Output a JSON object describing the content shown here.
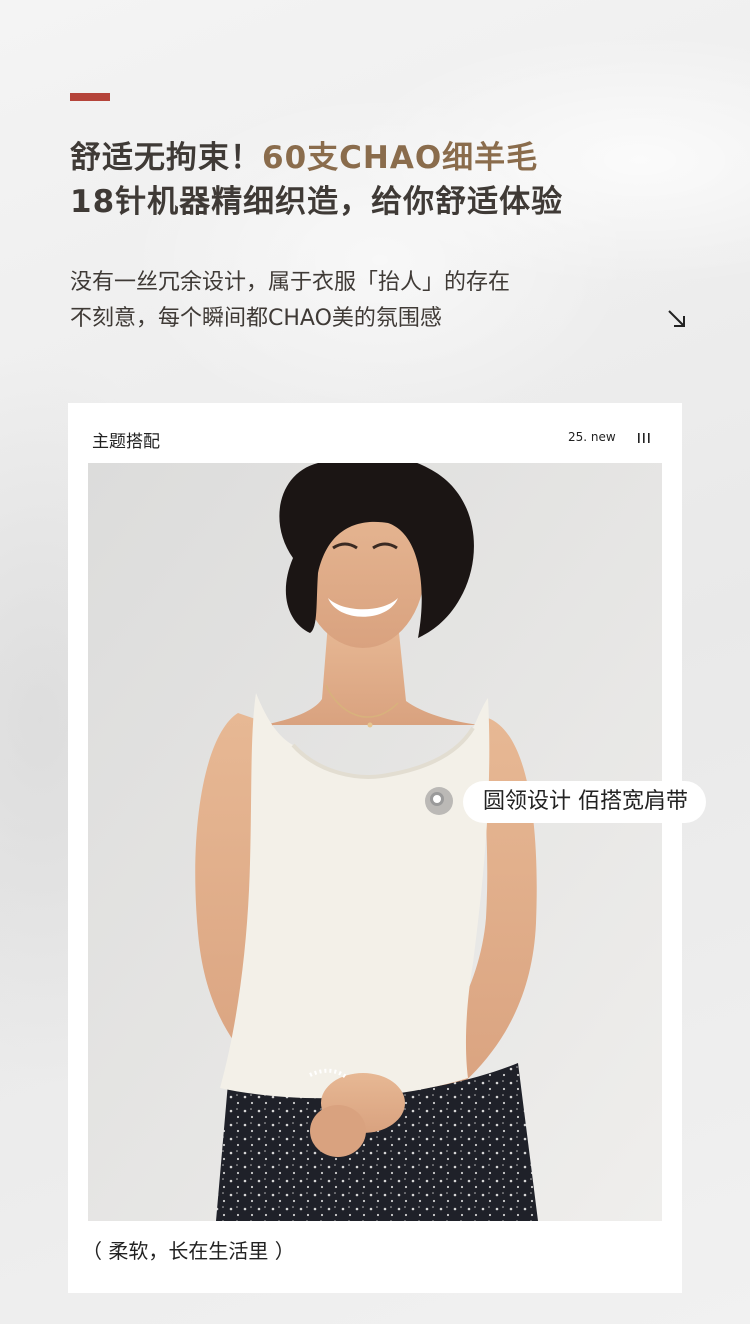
{
  "header": {
    "headline_line1_part1": "舒适无拘束！",
    "headline_line1_part2": "60支CHAO细羊毛",
    "headline_line2": "18针机器精细织造，给你舒适体验",
    "sub_line1": "没有一丝冗余设计，属于衣服「抬人」的存在",
    "sub_line2": "不刻意，每个瞬间都CHAO美的氛围感",
    "arrow_icon": "arrow-down-right-icon"
  },
  "card": {
    "title": "主题搭配",
    "tag": "25. new",
    "menu_icon": "vertical-lines-icon",
    "caption": "（ 柔软，长在生活里 ）"
  },
  "hotspot": {
    "label": "圆领设计 佰搭宽肩带"
  },
  "colors": {
    "accent_red": "#b5443a",
    "headline_dark": "#3f3a36",
    "headline_highlight": "#8a6c4c",
    "card_bg": "#ffffff"
  }
}
